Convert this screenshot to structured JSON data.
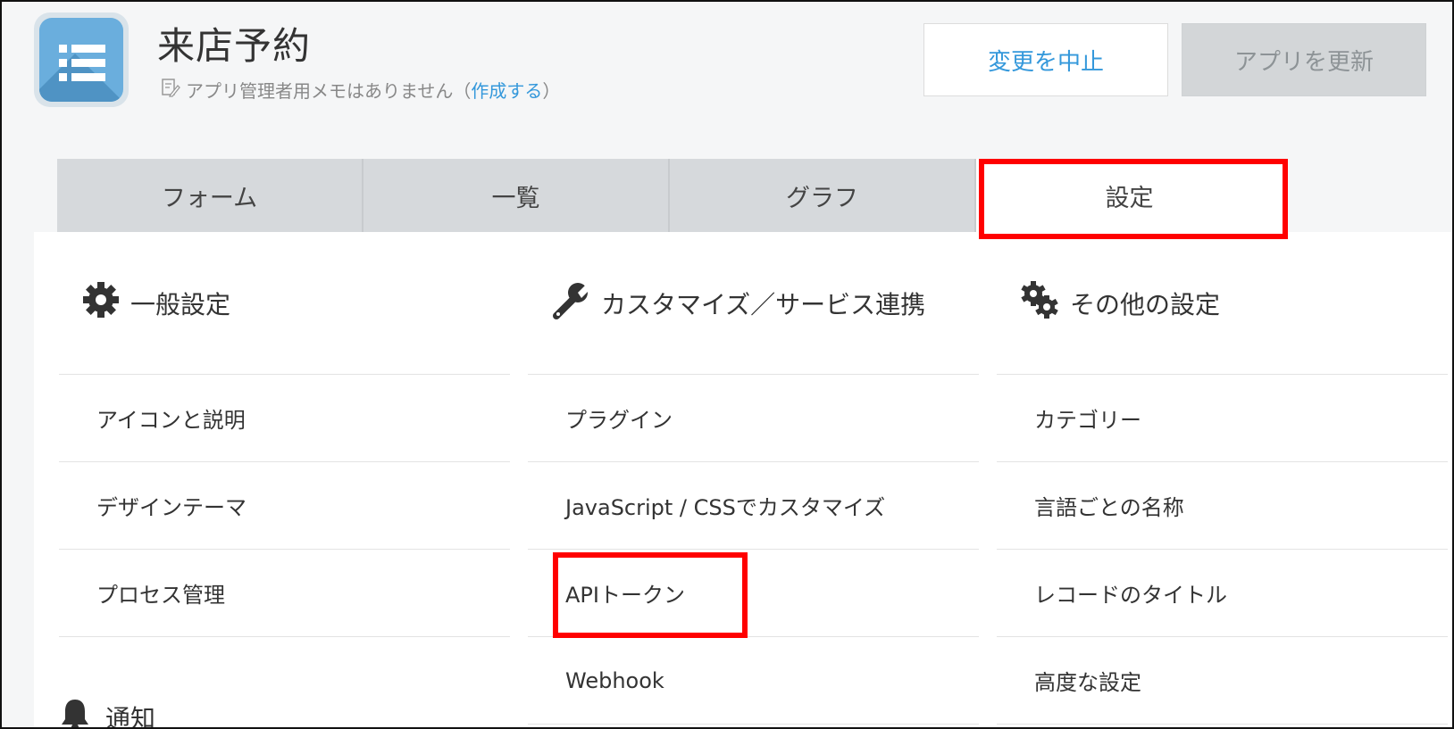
{
  "header": {
    "app_title": "来店予約",
    "memo_text": "アプリ管理者用メモはありません",
    "memo_paren_open": "（",
    "memo_link": "作成する",
    "memo_paren_close": "）",
    "cancel_label": "変更を中止",
    "update_label": "アプリを更新"
  },
  "tabs": [
    {
      "label": "フォーム"
    },
    {
      "label": "一覧"
    },
    {
      "label": "グラフ"
    },
    {
      "label": "設定",
      "active": true
    }
  ],
  "sections": {
    "general": {
      "title": "一般設定",
      "icon": "gear-icon",
      "items": [
        "アイコンと説明",
        "デザインテーマ",
        "プロセス管理"
      ]
    },
    "customize": {
      "title": "カスタマイズ／サービス連携",
      "icon": "wrench-icon",
      "items": [
        "プラグイン",
        "JavaScript / CSSでカスタマイズ",
        "APIトークン",
        "Webhook"
      ]
    },
    "other": {
      "title": "その他の設定",
      "icon": "gears-icon",
      "items": [
        "カテゴリー",
        "言語ごとの名称",
        "レコードのタイトル",
        "高度な設定"
      ]
    },
    "notification": {
      "title": "通知",
      "icon": "bell-icon"
    }
  },
  "colors": {
    "accent": "#3498db",
    "highlight": "#ff0000",
    "tab_bg": "#d6d9dc",
    "page_bg": "#f5f6f7"
  }
}
